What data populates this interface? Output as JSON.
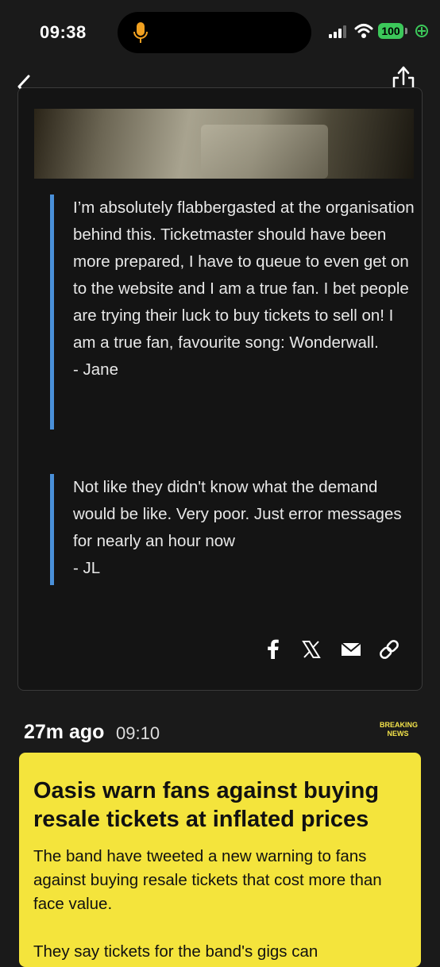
{
  "status_bar": {
    "time": "09:38",
    "battery": "100"
  },
  "quotes": [
    {
      "text": "I’m absolutely flabbergasted at the organisation behind this. Ticketmaster should have been more prepared, I have to queue to even get on to the website and I am a true fan. I bet people are trying their luck to buy tickets to sell on! I am a true fan, favourite song: Wonderwall.",
      "author": "- Jane"
    },
    {
      "text": "Not like they didn't know what the demand would be like. Very poor. Just error messages for nearly an hour now",
      "author": "- JL"
    }
  ],
  "share_icons": [
    "facebook-icon",
    "x-icon",
    "mail-icon",
    "link-icon"
  ],
  "entry": {
    "time_ago": "27m ago",
    "time": "09:10",
    "badge_line1": "BREAKING",
    "badge_line2": "NEWS",
    "headline": "Oasis warn fans against buying resale tickets at inflated prices",
    "body": "The band have tweeted a new warning to fans against buying resale tickets that cost more than face value.",
    "body_next": "They say tickets for the band's gigs can"
  },
  "colors": {
    "accent_blue": "#4a90d9",
    "breaking_yellow": "#f4e43c",
    "battery_green": "#3cc85a"
  }
}
